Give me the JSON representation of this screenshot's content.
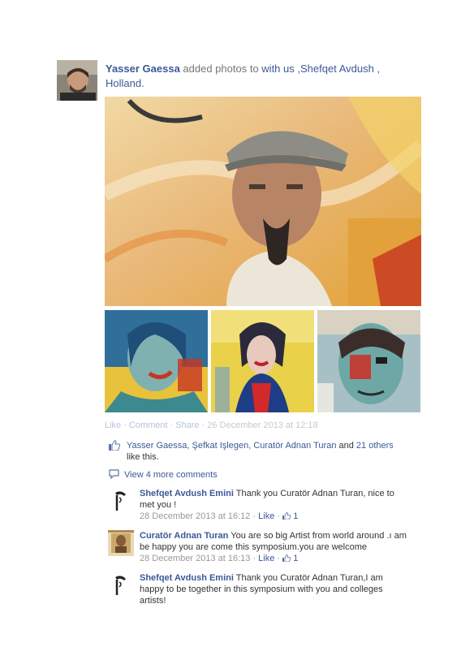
{
  "post": {
    "author": "Yasser Gaessa",
    "action_text": " added photos to ",
    "target": "with us ,Shefqet Avdush , Holland."
  },
  "actions": {
    "like": "Like",
    "comment": "Comment",
    "share": "Share",
    "timestamp": "26 December 2013 at 12:18"
  },
  "likes": {
    "names": "Yasser Gaessa, Şefkat Işlegen, Curatör Adnan Turan",
    "and": " and ",
    "others": "21 others",
    "suffix": " like this."
  },
  "view_more": "View 4 more comments",
  "comments": [
    {
      "author": "Shefqet Avdush Emini",
      "text": "Thank you Curatör Adnan Turan, nice to met you !",
      "time": "28 December 2013 at 16:12",
      "like": "Like",
      "like_count": "1"
    },
    {
      "author": "Curatör Adnan Turan",
      "text": "You are so big Artist from world around .ı am be happy you are come this symposium.you are welcome",
      "time": "28 December 2013 at 16:13",
      "like": "Like",
      "like_count": "1"
    },
    {
      "author": "Shefqet Avdush Emini",
      "text": "Thank you Curatör Adnan Turan,I am happy to be together in this symposium with you and colleges artists!"
    }
  ],
  "icons": {
    "like": "thumbs-up-icon",
    "comments": "comment-bubble-icon"
  }
}
